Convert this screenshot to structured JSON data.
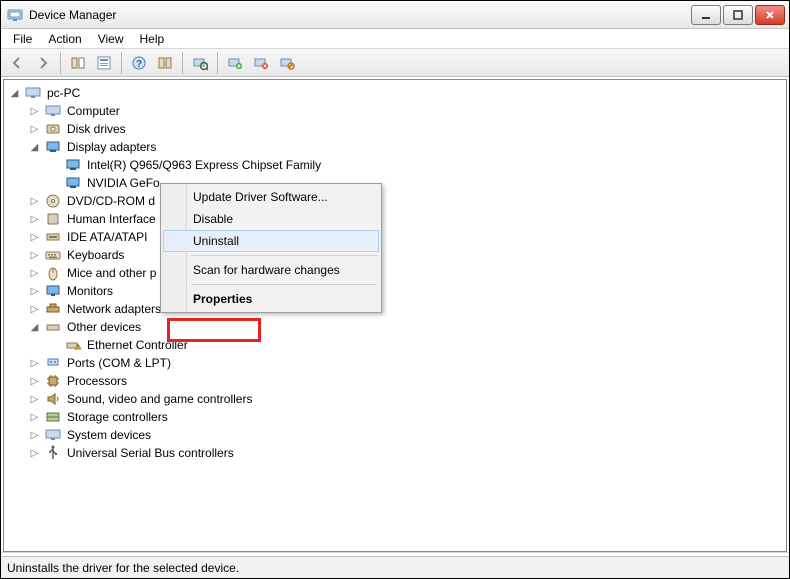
{
  "window": {
    "title": "Device Manager"
  },
  "menu": {
    "file": "File",
    "action": "Action",
    "view": "View",
    "help": "Help"
  },
  "tree": {
    "root": "pc-PC",
    "computer": "Computer",
    "disk_drives": "Disk drives",
    "display_adapters": "Display adapters",
    "display_adapter_1": "Intel(R)  Q965/Q963 Express Chipset Family",
    "display_adapter_2": "NVIDIA GeFo",
    "dvd": "DVD/CD-ROM d",
    "hid": "Human Interface",
    "ide": "IDE ATA/ATAPI",
    "keyboards": "Keyboards",
    "mice": "Mice and other p",
    "monitors": "Monitors",
    "network": "Network adapters",
    "other_devices": "Other devices",
    "ethernet_controller": "Ethernet Controller",
    "ports": "Ports (COM & LPT)",
    "processors": "Processors",
    "sound": "Sound, video and game controllers",
    "storage": "Storage controllers",
    "system": "System devices",
    "usb": "Universal Serial Bus controllers"
  },
  "context_menu": {
    "update": "Update Driver Software...",
    "disable": "Disable",
    "uninstall": "Uninstall",
    "scan": "Scan for hardware changes",
    "properties": "Properties"
  },
  "status": {
    "text": "Uninstalls the driver for the selected device."
  }
}
